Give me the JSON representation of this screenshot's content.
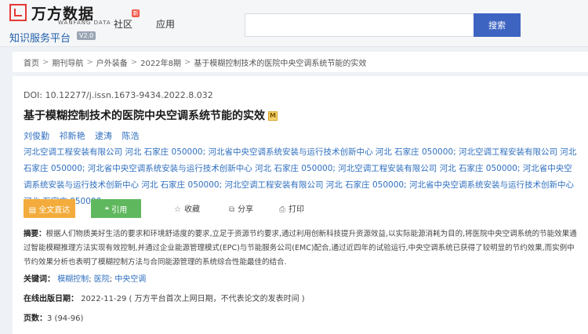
{
  "header": {
    "logo_cn": "万方数据",
    "logo_en": "WANFANG DATA",
    "platform": "知识服务平台",
    "version": "V2.0",
    "nav": [
      {
        "label": "社区",
        "badge": "新"
      },
      {
        "label": "应用"
      }
    ],
    "search": {
      "value": "",
      "placeholder": "",
      "button": "搜索"
    }
  },
  "breadcrumb": [
    "首页",
    "期刊导航",
    "户外装备",
    "2022年8期",
    "基于模糊控制技术的医院中央空调系统节能的实效"
  ],
  "breadcrumb_sep": ">",
  "article": {
    "doi": "DOI: 10.12277/j.issn.1673-9434.2022.8.032",
    "title": "基于模糊控制技术的医院中央空调系统节能的实效",
    "title_badge": "M",
    "authors": [
      "刘俊勤",
      "祁新艳",
      "逮涛",
      "陈浩"
    ],
    "affiliations": "河北空调工程安装有限公司 河北 石家庄 050000; 河北省中央空调系统安装与运行技术创新中心 河北 石家庄 050000; 河北空调工程安装有限公司 河北 石家庄 050000; 河北省中央空调系统安装与运行技术创新中心 河北 石家庄 050000; 河北空调工程安装有限公司 河北 石家庄 050000; 河北省中央空调系统安装与运行技术创新中心 河北 石家庄 050000; 河北空调工程安装有限公司 河北 石家庄 050000; 河北省中央空调系统安装与运行技术创新中心 河北 石家庄 050000",
    "actions": {
      "fulltext": "全文直达",
      "cite": "引用",
      "favorite": "收藏",
      "share": "分享",
      "print": "打印"
    },
    "abstract_label": "摘要：",
    "abstract": "根据人们物质美好生活的要求和环境舒适度的要求,立足于资源节约要求,通过利用创新科技提升资源效益,以实际能源消耗为目的,将医院中央空调系统的节能效果通过智能模糊推理方法实现有效控制,并通过企业能源管理模式(EPC)与节能服务公司(EMC)配合,通过近四年的试验运行,中央空调系统已获得了较明显的节约效果,而实例中节约效果分析也表明了模糊控制方法与合同能源管理的系统综合性能最佳的结合.",
    "keywords_label": "关键词：",
    "keywords": [
      "模糊控制",
      "医院",
      "中央空调"
    ],
    "keyword_sep": ";",
    "pubdate_label": "在线出版日期：",
    "pubdate": "2022-11-29",
    "pubdate_note": "( 万方平台首次上网日期，不代表论文的发表时间 )",
    "pages_label": "页数：",
    "pages": "3 (94-96)"
  },
  "icons": {
    "fulltext": "document-icon",
    "cite": "quote-icon",
    "favorite": "star-icon",
    "share": "share-icon",
    "print": "printer-icon"
  },
  "colors": {
    "brand_red": "#e53935",
    "link_blue": "#2f6fbf",
    "search_button": "#3e64c2",
    "fulltext_button": "#f3ac3c",
    "cite_button": "#5fb85e"
  }
}
